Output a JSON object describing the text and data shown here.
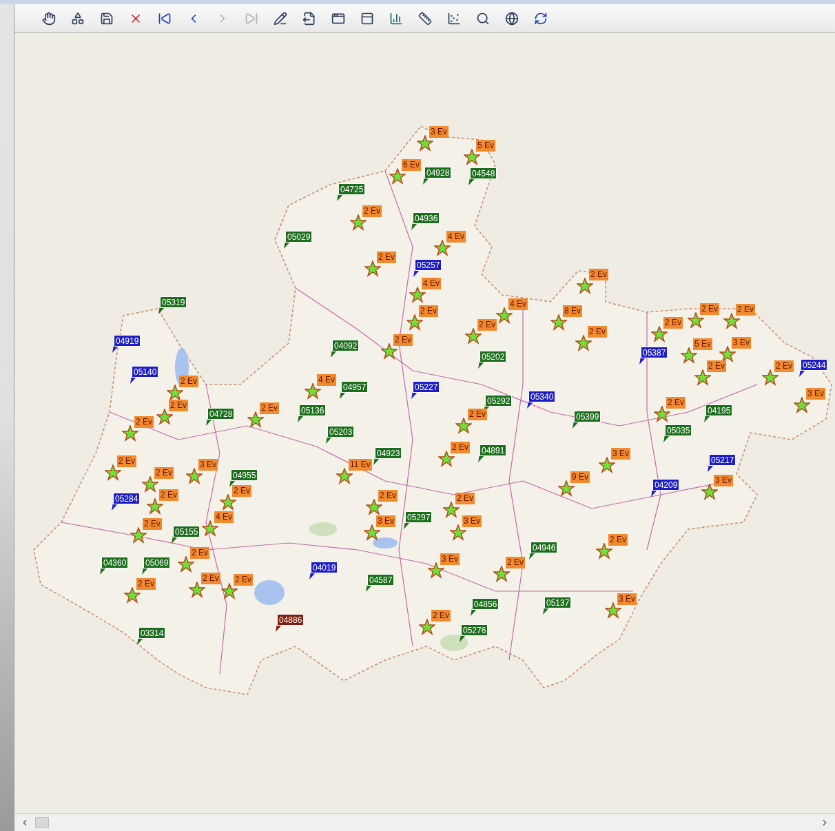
{
  "toolbar": {
    "buttons": [
      {
        "kind": "hand",
        "disabled": false
      },
      {
        "kind": "shapes",
        "disabled": false
      },
      {
        "kind": "save",
        "disabled": false
      },
      {
        "kind": "delete",
        "disabled": false
      },
      {
        "kind": "first",
        "disabled": false
      },
      {
        "kind": "previous",
        "disabled": false
      },
      {
        "kind": "next",
        "disabled": true
      },
      {
        "kind": "last",
        "disabled": true
      },
      {
        "kind": "edit",
        "disabled": false
      },
      {
        "kind": "export",
        "disabled": false
      },
      {
        "kind": "window",
        "disabled": false
      },
      {
        "kind": "panel",
        "disabled": false
      },
      {
        "kind": "chart",
        "disabled": false
      },
      {
        "kind": "ruler",
        "disabled": false
      },
      {
        "kind": "scatter",
        "disabled": false
      },
      {
        "kind": "search",
        "disabled": false
      },
      {
        "kind": "globe",
        "disabled": false
      },
      {
        "kind": "refresh",
        "disabled": false
      }
    ]
  },
  "map": {
    "events": [
      {
        "label": "3 Ev"
      },
      {
        "label": "5 Ev"
      },
      {
        "label": "6 Ev"
      },
      {
        "label": "2 Ev"
      },
      {
        "label": "4 Ev"
      },
      {
        "label": "2 Ev"
      },
      {
        "label": "4 Ev"
      },
      {
        "label": "2 Ev"
      },
      {
        "label": "2 Ev"
      },
      {
        "label": "2 Ev"
      },
      {
        "label": "4 Ev"
      },
      {
        "label": "2 Ev"
      },
      {
        "label": "8 Ev"
      },
      {
        "label": "2 Ev"
      },
      {
        "label": "2 Ev"
      },
      {
        "label": "2 Ev"
      },
      {
        "label": "2 Ev"
      },
      {
        "label": "5 Ev"
      },
      {
        "label": "3 Ev"
      },
      {
        "label": "2 Ev"
      },
      {
        "label": "2 Ev"
      },
      {
        "label": "3 Ev"
      },
      {
        "label": "2 Ev"
      },
      {
        "label": "4 Ev"
      },
      {
        "label": "2 Ev"
      },
      {
        "label": "2 Ev"
      },
      {
        "label": "2 Ev"
      },
      {
        "label": "2 Ev"
      },
      {
        "label": "2 Ev"
      },
      {
        "label": "2 Ev"
      },
      {
        "label": "3 Ev"
      },
      {
        "label": "9 Ev"
      },
      {
        "label": "3 Ev"
      },
      {
        "label": "2 Ev"
      },
      {
        "label": "2 Ev"
      },
      {
        "label": "3 Ev"
      },
      {
        "label": "11 Ev"
      },
      {
        "label": "2 Ev"
      },
      {
        "label": "2 Ev"
      },
      {
        "label": "2 Ev"
      },
      {
        "label": "4 Ev"
      },
      {
        "label": "2 Ev"
      },
      {
        "label": "3 Ev"
      },
      {
        "label": "2 Ev"
      },
      {
        "label": "3 Ev"
      },
      {
        "label": "2 Ev"
      },
      {
        "label": "2 Ev"
      },
      {
        "label": "2 Ev"
      },
      {
        "label": "2 Ev"
      },
      {
        "label": "3 Ev"
      },
      {
        "label": "2 Ev"
      },
      {
        "label": "2 Ev"
      },
      {
        "label": "3 Ev"
      },
      {
        "label": "2 Ev"
      }
    ],
    "stations": [
      {
        "label": "04928",
        "color": "#1b6e1b"
      },
      {
        "label": "04548",
        "color": "#1b6e1b"
      },
      {
        "label": "04725",
        "color": "#1b6e1b"
      },
      {
        "label": "04936",
        "color": "#1b6e1b"
      },
      {
        "label": "05029",
        "color": "#1b6e1b"
      },
      {
        "label": "05257",
        "color": "#1d1dc8"
      },
      {
        "label": "05319",
        "color": "#1b6e1b"
      },
      {
        "label": "04919",
        "color": "#1d1dc8"
      },
      {
        "label": "05140",
        "color": "#1d1dc8"
      },
      {
        "label": "04092",
        "color": "#1b6e1b"
      },
      {
        "label": "05202",
        "color": "#1b6e1b"
      },
      {
        "label": "05387",
        "color": "#1d1dc8"
      },
      {
        "label": "05244",
        "color": "#1d1dc8"
      },
      {
        "label": "04957",
        "color": "#1b6e1b"
      },
      {
        "label": "05227",
        "color": "#1d1dc8"
      },
      {
        "label": "05292",
        "color": "#1b6e1b"
      },
      {
        "label": "05340",
        "color": "#1d1dc8"
      },
      {
        "label": "04728",
        "color": "#1b6e1b"
      },
      {
        "label": "05136",
        "color": "#1b6e1b"
      },
      {
        "label": "05399",
        "color": "#1b6e1b"
      },
      {
        "label": "04195",
        "color": "#1b6e1b"
      },
      {
        "label": "05035",
        "color": "#1b6e1b"
      },
      {
        "label": "05203",
        "color": "#1b6e1b"
      },
      {
        "label": "04923",
        "color": "#1b6e1b"
      },
      {
        "label": "04891",
        "color": "#1b6e1b"
      },
      {
        "label": "05217",
        "color": "#1d1dc8"
      },
      {
        "label": "04955",
        "color": "#1b6e1b"
      },
      {
        "label": "05284",
        "color": "#1d1dc8"
      },
      {
        "label": "04209",
        "color": "#1d1dc8"
      },
      {
        "label": "05297",
        "color": "#1b6e1b"
      },
      {
        "label": "05155",
        "color": "#1b6e1b"
      },
      {
        "label": "04946",
        "color": "#1b6e1b"
      },
      {
        "label": "04360",
        "color": "#1b6e1b"
      },
      {
        "label": "05069",
        "color": "#1b6e1b"
      },
      {
        "label": "04019",
        "color": "#1d1dc8"
      },
      {
        "label": "04587",
        "color": "#1b6e1b"
      },
      {
        "label": "04856",
        "color": "#1b6e1b"
      },
      {
        "label": "05137",
        "color": "#1b6e1b"
      },
      {
        "label": "04886",
        "color": "#7b1e0e"
      },
      {
        "label": "05276",
        "color": "#1b6e1b"
      },
      {
        "label": "03314",
        "color": "#1b6e1b"
      }
    ]
  }
}
